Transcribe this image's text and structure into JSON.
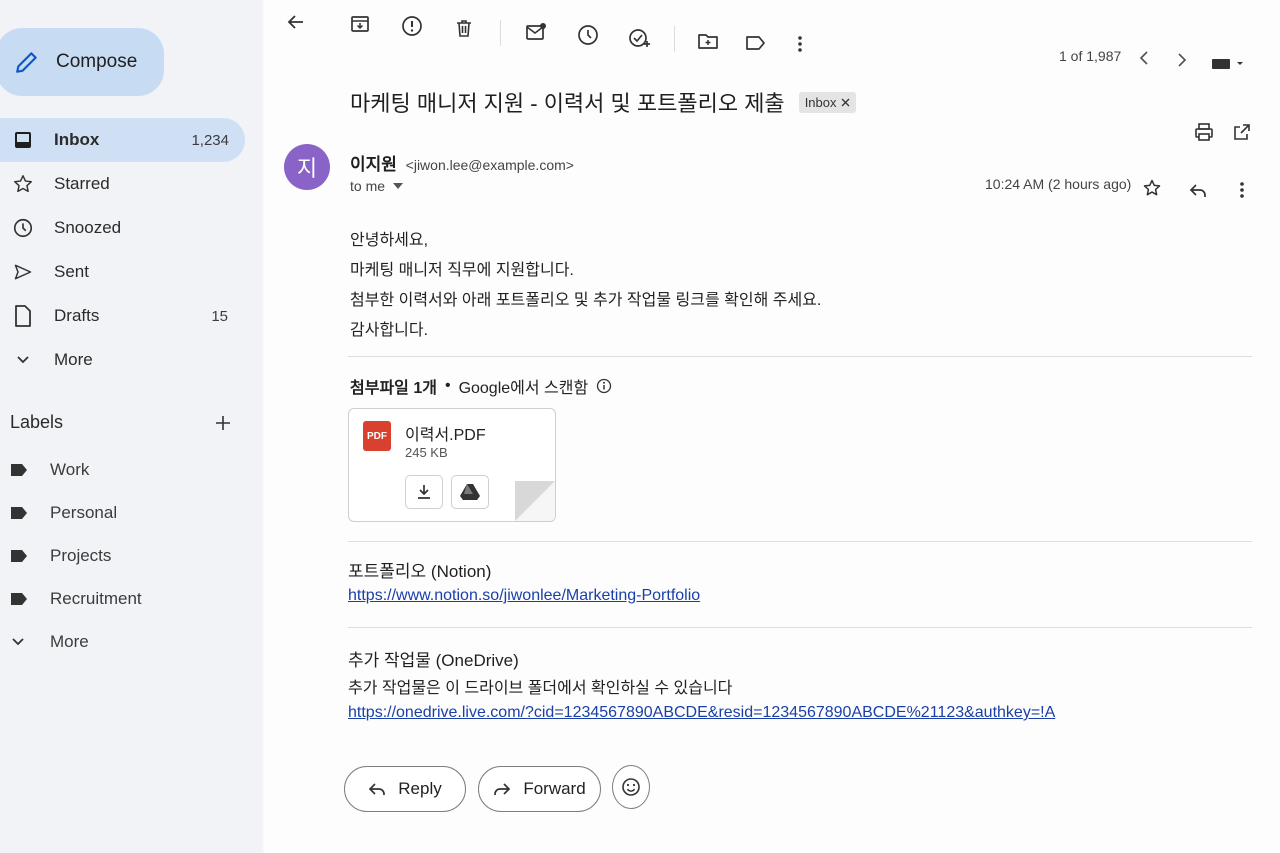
{
  "sidebar": {
    "compose_label": "Compose",
    "nav": [
      {
        "label": "Inbox",
        "count": "1,234",
        "icon": "inbox-icon"
      },
      {
        "label": "Starred",
        "count": "",
        "icon": "star-icon"
      },
      {
        "label": "Snoozed",
        "count": "",
        "icon": "clock-icon"
      },
      {
        "label": "Sent",
        "count": "",
        "icon": "send-icon"
      },
      {
        "label": "Drafts",
        "count": "15",
        "icon": "file-icon"
      },
      {
        "label": "More",
        "count": "",
        "icon": "chevron-down-icon"
      }
    ],
    "labels_title": "Labels",
    "labels": [
      {
        "label": "Work"
      },
      {
        "label": "Personal"
      },
      {
        "label": "Projects"
      },
      {
        "label": "Recruitment"
      }
    ],
    "labels_more": "More"
  },
  "toolbar": {
    "page_count": "1 of 1,987"
  },
  "email": {
    "subject": "마케팅 매니저 지원 - 이력서 및 포트폴리오 제출",
    "badge": "Inbox",
    "avatar_letter": "지",
    "sender_name": "이지원",
    "sender_email": "<jiwon.lee@example.com>",
    "to": "to me",
    "time": "10:24 AM (2 hours ago)",
    "body": [
      "안녕하세요,",
      "마케팅 매니저 직무에 지원합니다.",
      "첨부한 이력서와 아래 포트폴리오 및 추가 작업물 링크를 확인해 주세요.",
      "감사합니다."
    ],
    "attachments_label": "첨부파일 1개",
    "scan_note": "Google에서 스캔함",
    "attachment": {
      "name": "이력서.PDF",
      "size": "245 KB",
      "type_label": "PDF"
    },
    "portfolio_title": "포트폴리오 (Notion)",
    "portfolio_link": "https://www.notion.so/jiwonlee/Marketing-Portfolio",
    "extra_title": "추가 작업물 (OneDrive)",
    "extra_text": "추가 작업물은 이 드라이브 폴더에서 확인하실 수 있습니다",
    "extra_link": "https://onedrive.live.com/?cid=1234567890ABCDE&resid=1234567890ABCDE%21123&authkey=!A"
  },
  "actions": {
    "reply": "Reply",
    "forward": "Forward"
  }
}
